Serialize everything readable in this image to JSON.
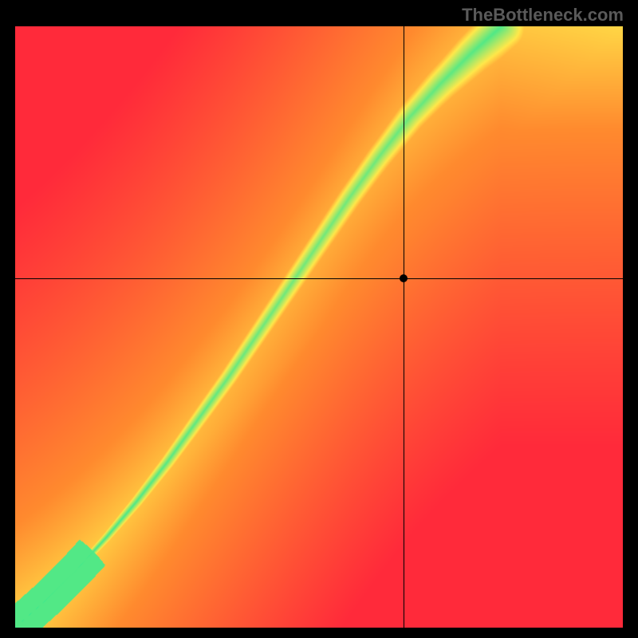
{
  "watermark": "TheBottleneck.com",
  "colors": {
    "red": "#ff2a3a",
    "orange": "#ff8a2e",
    "yellow": "#ffe84a",
    "green": "#18e89a",
    "black": "#000000",
    "watermark": "#5a5a5a"
  },
  "chart_data": {
    "type": "heatmap",
    "title": "",
    "xlabel": "",
    "ylabel": "",
    "xlim": [
      0,
      1
    ],
    "ylim": [
      0,
      1
    ],
    "marker": {
      "x": 0.64,
      "y": 0.58
    },
    "crosshair": {
      "x": 0.64,
      "y": 0.58
    },
    "ridge": [
      {
        "x": 0.0,
        "y": 0.0
      },
      {
        "x": 0.05,
        "y": 0.045
      },
      {
        "x": 0.1,
        "y": 0.095
      },
      {
        "x": 0.15,
        "y": 0.15
      },
      {
        "x": 0.2,
        "y": 0.21
      },
      {
        "x": 0.25,
        "y": 0.275
      },
      {
        "x": 0.3,
        "y": 0.345
      },
      {
        "x": 0.35,
        "y": 0.415
      },
      {
        "x": 0.4,
        "y": 0.49
      },
      {
        "x": 0.45,
        "y": 0.565
      },
      {
        "x": 0.5,
        "y": 0.64
      },
      {
        "x": 0.55,
        "y": 0.715
      },
      {
        "x": 0.6,
        "y": 0.785
      },
      {
        "x": 0.65,
        "y": 0.85
      },
      {
        "x": 0.7,
        "y": 0.905
      },
      {
        "x": 0.75,
        "y": 0.955
      },
      {
        "x": 0.8,
        "y": 1.0
      }
    ],
    "ridge_half_width": [
      {
        "x": 0.0,
        "w": 0.002
      },
      {
        "x": 0.1,
        "w": 0.012
      },
      {
        "x": 0.2,
        "w": 0.022
      },
      {
        "x": 0.3,
        "w": 0.03
      },
      {
        "x": 0.4,
        "w": 0.035
      },
      {
        "x": 0.5,
        "w": 0.04
      },
      {
        "x": 0.6,
        "w": 0.046
      },
      {
        "x": 0.7,
        "w": 0.06
      },
      {
        "x": 0.8,
        "w": 0.085
      },
      {
        "x": 0.9,
        "w": 0.1
      },
      {
        "x": 1.0,
        "w": 0.115
      }
    ],
    "colorscale_note": "value 0 = red, ~0.55 = yellow, 1 = green (ridge center)"
  }
}
